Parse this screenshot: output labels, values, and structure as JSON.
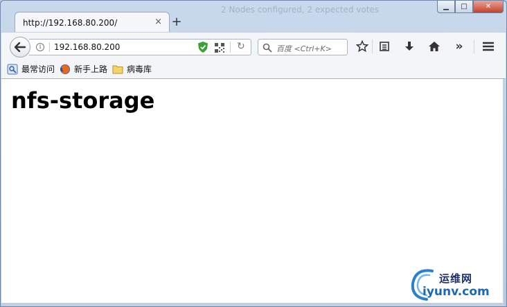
{
  "window": {
    "ghost_title": "2 Nodes configured, 2 expected votes",
    "controls": {
      "minimize": "▁",
      "maximize": "□",
      "close": "✕"
    }
  },
  "tab": {
    "title": "http://192.168.80.200/",
    "close": "×",
    "new_tab": "+"
  },
  "navbar": {
    "url": "192.168.80.200",
    "search_placeholder": "百度 <Ctrl+K>",
    "overflow": "»"
  },
  "bookmarks": [
    {
      "label": "最常访问",
      "icon": "pin-icon"
    },
    {
      "label": "新手上路",
      "icon": "firefox-icon"
    },
    {
      "label": "病毒库",
      "icon": "folder-icon"
    }
  ],
  "page": {
    "heading": "nfs-storage"
  },
  "watermark": {
    "top": "运维网",
    "bottom": "iyunv.com"
  },
  "colors": {
    "accent": "#1b67b8",
    "shield": "#3aa335"
  }
}
